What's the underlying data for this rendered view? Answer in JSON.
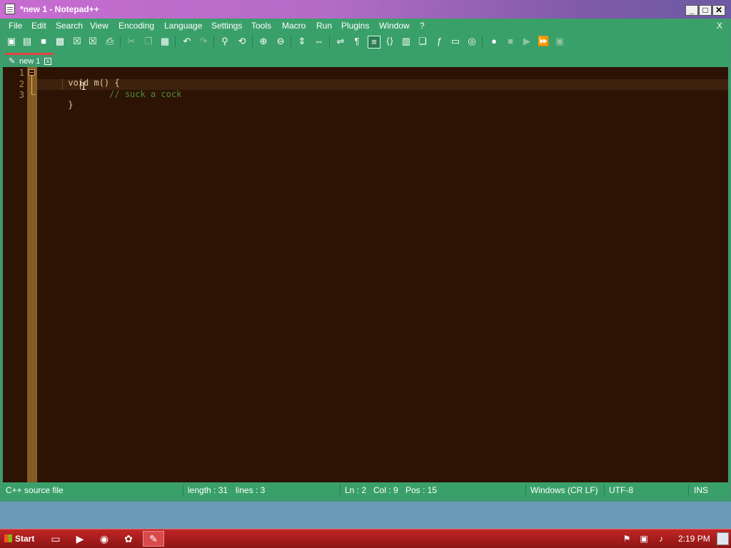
{
  "window": {
    "title": "*new 1 - Notepad++",
    "min_label": "_",
    "max_label": "□",
    "close_label": "✕"
  },
  "menu": {
    "items": [
      "File",
      "Edit",
      "Search",
      "View",
      "Encoding",
      "Language",
      "Settings",
      "Tools",
      "Macro",
      "Run",
      "Plugins",
      "Window",
      "?"
    ],
    "close_doc_label": "X"
  },
  "toolbar": {
    "icons": [
      "new-file-icon",
      "open-file-icon",
      "save-icon",
      "save-all-icon",
      "close-icon",
      "close-all-icon",
      "print-icon",
      "cut-icon",
      "copy-icon",
      "paste-icon",
      "undo-icon",
      "redo-icon",
      "find-icon",
      "replace-icon",
      "zoom-in-icon",
      "zoom-out-icon",
      "sync-vertical-icon",
      "sync-horizontal-icon",
      "word-wrap-icon",
      "show-all-chars-icon",
      "indent-guide-icon",
      "xml-tag-icon",
      "document-map-icon",
      "doc-list-icon",
      "function-list-icon",
      "monitor-icon",
      "screenshot-icon",
      "record-macro-icon",
      "stop-macro-icon",
      "play-macro-icon",
      "run-macro-multiple-icon",
      "save-macro-icon"
    ]
  },
  "tab": {
    "label": "new 1",
    "close_label": "x"
  },
  "editor": {
    "line_numbers": [
      "1",
      "2",
      "3"
    ],
    "lines": [
      {
        "code": "void m() {",
        "comment": ""
      },
      {
        "code": "        ",
        "comment": "// suck a cock"
      },
      {
        "code": "}",
        "comment": ""
      }
    ]
  },
  "status": {
    "file_type": "C++ source file",
    "length": "length : 31",
    "lines": "lines : 3",
    "ln": "Ln : 2",
    "col": "Col : 9",
    "pos": "Pos : 15",
    "eol": "Windows (CR LF)",
    "encoding": "UTF-8",
    "mode": "INS"
  },
  "taskbar": {
    "start_label": "Start",
    "clock": "2:19 PM"
  },
  "colors": {
    "editor_bg": "#2c1304",
    "title_accent": "#c86cd0",
    "chrome": "#3aa06a",
    "taskbar": "#c02626",
    "comment": "#4a8c3c"
  }
}
